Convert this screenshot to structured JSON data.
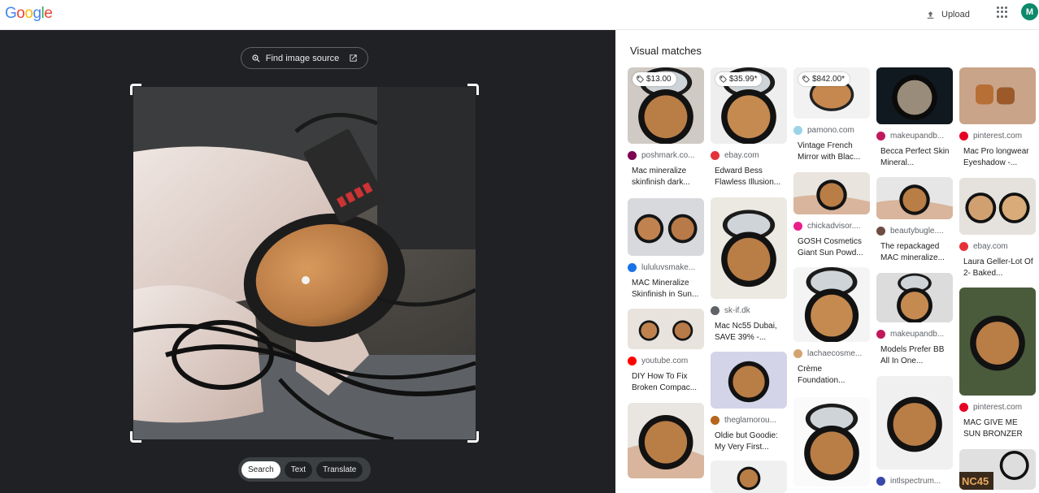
{
  "header": {
    "logo_letters": [
      "G",
      "o",
      "o",
      "g",
      "l",
      "e"
    ],
    "logo_colors": [
      "#4285f4",
      "#ea4335",
      "#fbbc05",
      "#4285f4",
      "#34a853",
      "#ea4335"
    ],
    "upload_label": "Upload",
    "upload_icon": "upload-icon",
    "apps_icon": "apps-grid-icon",
    "avatar_letter": "M",
    "avatar_color": "#0d8a6b"
  },
  "left": {
    "find_source_label": "Find image source",
    "find_source_icon": "lens-search-icon",
    "open_icon": "open-in-new-icon",
    "modes": [
      "Search",
      "Text",
      "Translate"
    ],
    "active_mode": "Search"
  },
  "right": {
    "title": "Visual matches",
    "columns": [
      [
        {
          "price": "$13.00",
          "source": "poshmark.co...",
          "title": "Mac mineralize skinfinish dark...",
          "favicon_color": "#7f0353",
          "thumb": "compact-open"
        },
        {
          "price": "",
          "source": "lululuvsmake...",
          "title": "MAC Mineralize Skinfinish in Sun...",
          "favicon_color": "#1a73e8",
          "thumb": "compact-pair"
        },
        {
          "price": "",
          "source": "youtube.com",
          "title": "DIY How To Fix Broken Compac...",
          "favicon_color": "#ff0000",
          "thumb": "compact-broken"
        },
        {
          "price": "",
          "source": "",
          "title": "",
          "favicon_color": "#999999",
          "thumb": "compact-hand"
        }
      ],
      [
        {
          "price": "$35.99*",
          "source": "ebay.com",
          "title": "Edward Bess Flawless Illusion...",
          "favicon_color": "#e53238",
          "thumb": "compact-mirror"
        },
        {
          "price": "",
          "source": "sk-if.dk",
          "title": "Mac Nc55 Dubai, SAVE 39% -...",
          "favicon_color": "#5f6368",
          "thumb": "compact-tall"
        },
        {
          "price": "",
          "source": "theglamorou...",
          "title": "Oldie but Goodie: My Very First...",
          "favicon_color": "#b5651d",
          "thumb": "compact-purple"
        },
        {
          "price": "",
          "source": "",
          "title": "",
          "favicon_color": "#999999",
          "thumb": "compact-dark"
        }
      ],
      [
        {
          "price": "$842.00*",
          "source": "pamono.com",
          "title": "Vintage French Mirror with Blac...",
          "favicon_color": "#9bd3e8",
          "thumb": "mirror-round"
        },
        {
          "price": "",
          "source": "chickadvisor....",
          "title": "GOSH Cosmetics Giant Sun Powd...",
          "favicon_color": "#e91e8c",
          "thumb": "compact-hand-small"
        },
        {
          "price": "",
          "source": "lachaecosme...",
          "title": "Crème Foundation...",
          "favicon_color": "#d4a373",
          "thumb": "compact-mirror-tall"
        },
        {
          "price": "",
          "source": "",
          "title": "",
          "favicon_color": "#999999",
          "thumb": "compact-open-big"
        }
      ],
      [
        {
          "price": "",
          "source": "makeupandb...",
          "title": "Becca Perfect Skin Mineral...",
          "favicon_color": "#c2185b",
          "thumb": "compact-dark-close"
        },
        {
          "price": "",
          "source": "beautybugle....",
          "title": "The repackaged MAC mineralize...",
          "favicon_color": "#6d4c41",
          "thumb": "compact-hand-flat"
        },
        {
          "price": "",
          "source": "makeupandb...",
          "title": "Models Prefer BB All In One...",
          "favicon_color": "#c2185b",
          "thumb": "compact-mirror-side"
        },
        {
          "price": "",
          "source": "intlspectrum...",
          "title": "",
          "favicon_color": "#3949ab",
          "thumb": "compact-deep"
        }
      ],
      [
        {
          "price": "",
          "source": "pinterest.com",
          "title": "Mac Pro longwear Eyeshadow -...",
          "favicon_color": "#e60023",
          "thumb": "swatch-arm"
        },
        {
          "price": "",
          "source": "ebay.com",
          "title": "Laura Geller-Lot Of 2- Baked...",
          "favicon_color": "#e53238",
          "thumb": "compact-two"
        },
        {
          "price": "",
          "source": "pinterest.com",
          "title": "MAC GIVE ME SUN BRONZER //...",
          "favicon_color": "#e60023",
          "thumb": "compact-outdoor"
        },
        {
          "price": "",
          "source": "",
          "title": "NC45",
          "favicon_color": "#999999",
          "thumb": "nc45-label"
        }
      ]
    ]
  }
}
